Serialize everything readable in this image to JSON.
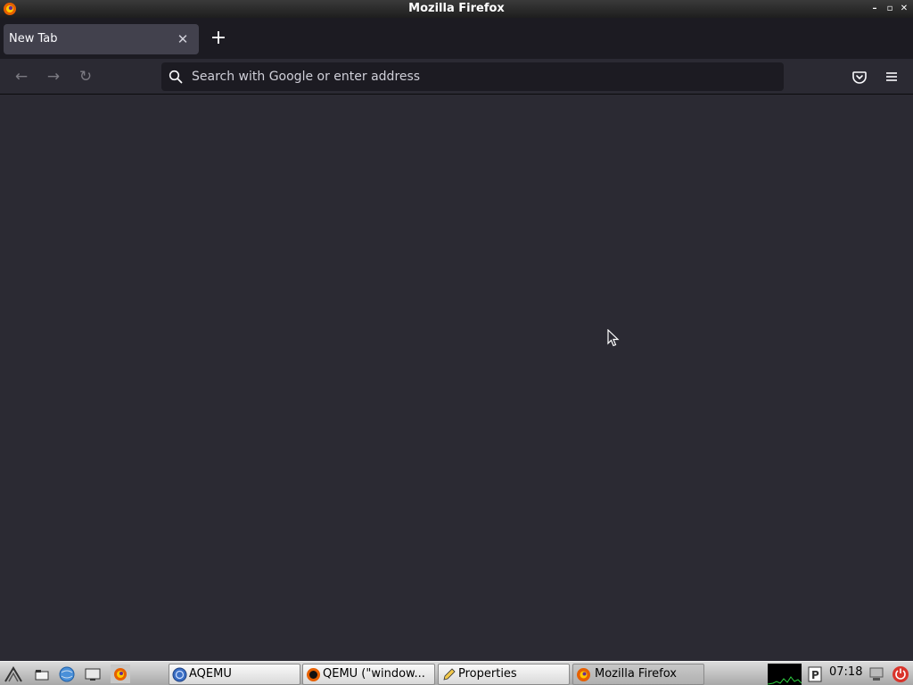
{
  "window": {
    "title": "Mozilla Firefox",
    "app_icon": "firefox-icon",
    "controls": {
      "minimize": "–",
      "restore": "▫",
      "close": "✕"
    }
  },
  "tabs": [
    {
      "title": "New Tab",
      "close_icon": "close-icon",
      "active": true
    }
  ],
  "new_tab_icon": "plus-icon",
  "navigation": {
    "back_icon": "←",
    "forward_icon": "→",
    "reload_icon": "↻",
    "urlbar": {
      "placeholder": "Search with Google or enter address",
      "value": ""
    },
    "pocket_icon": "pocket-icon",
    "menu_icon": "hamburger-menu-icon"
  },
  "taskbar": {
    "launchers": [
      "start-menu-icon",
      "file-manager-icon",
      "browser-launcher-icon",
      "show-desktop-icon",
      "firefox-launcher-icon"
    ],
    "tasks": [
      {
        "label": "AQEMU",
        "icon": "aqemu-icon",
        "active": false
      },
      {
        "label": "QEMU (\"window...",
        "icon": "qemu-icon",
        "active": false
      },
      {
        "label": "Properties",
        "icon": "pencil-icon",
        "active": false
      },
      {
        "label": "Mozilla Firefox",
        "icon": "firefox-icon",
        "active": true
      }
    ],
    "clock": "07:18"
  },
  "colors": {
    "content_bg": "#2b2a33",
    "tabstrip_bg": "#1c1b22",
    "active_tab_bg": "#42414d"
  }
}
